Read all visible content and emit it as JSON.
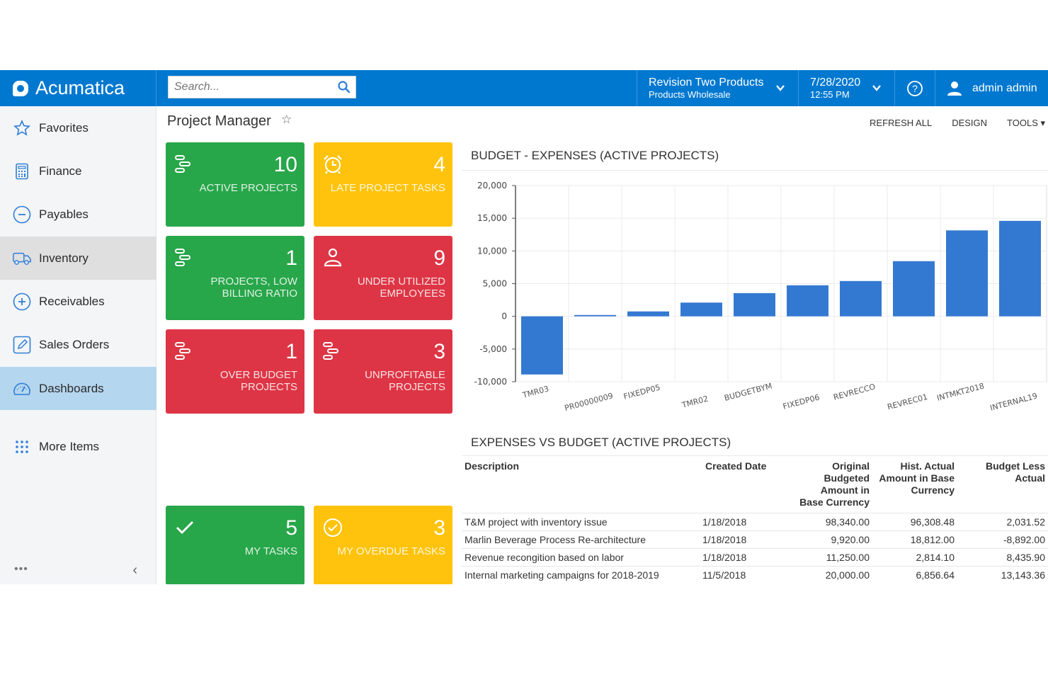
{
  "header": {
    "brand": "Acumatica",
    "search_placeholder": "Search...",
    "company": {
      "name": "Revision Two Products",
      "branch": "Products Wholesale"
    },
    "date": "7/28/2020",
    "time": "12:55 PM",
    "user": "admin admin"
  },
  "sidebar": {
    "items": [
      {
        "label": "Favorites",
        "icon": "star-icon"
      },
      {
        "label": "Finance",
        "icon": "calculator-icon"
      },
      {
        "label": "Payables",
        "icon": "minus-circle-icon"
      },
      {
        "label": "Inventory",
        "icon": "truck-icon"
      },
      {
        "label": "Receivables",
        "icon": "plus-circle-icon"
      },
      {
        "label": "Sales Orders",
        "icon": "pencil-square-icon"
      },
      {
        "label": "Dashboards",
        "icon": "gauge-icon"
      },
      {
        "label": "More Items",
        "icon": "grid-dots-icon"
      }
    ],
    "more_label": "•••",
    "collapse_label": "‹"
  },
  "page": {
    "title": "Project Manager",
    "star": "☆",
    "toolbar": {
      "refresh": "REFRESH ALL",
      "design": "DESIGN",
      "tools": "TOOLS ▾"
    }
  },
  "tiles": [
    {
      "value": "10",
      "label": "ACTIVE PROJECTS",
      "color": "green",
      "icon": "projects-icon"
    },
    {
      "value": "4",
      "label": "LATE PROJECT TASKS",
      "color": "yellow",
      "icon": "alarm-clock-icon"
    },
    {
      "value": "1",
      "label": "PROJECTS, LOW BILLING RATIO",
      "color": "green",
      "icon": "projects-icon"
    },
    {
      "value": "9",
      "label": "UNDER UTILIZED EMPLOYEES",
      "color": "red",
      "icon": "user-icon"
    },
    {
      "value": "1",
      "label": "OVER BUDGET PROJECTS",
      "color": "red",
      "icon": "projects-icon"
    },
    {
      "value": "3",
      "label": "UNPROFITABLE PROJECTS",
      "color": "red",
      "icon": "projects-icon"
    },
    {
      "value": "5",
      "label": "MY TASKS",
      "color": "green",
      "icon": "checkmark-icon"
    },
    {
      "value": "3",
      "label": "MY OVERDUE TASKS",
      "color": "yellow",
      "icon": "check-circle-icon"
    }
  ],
  "colors": {
    "green": "#28a64a",
    "yellow": "#ffc30d",
    "red": "#dd3545",
    "brand": "#0078d0",
    "bar": "#3479d1"
  },
  "chart_data": {
    "type": "bar",
    "title": "BUDGET - EXPENSES (ACTIVE PROJECTS)",
    "xlabel": "",
    "ylabel": "",
    "categories": [
      "TMR03",
      "PR00000009",
      "FIXEDP05",
      "TMR02",
      "BUDGETBYM",
      "FIXEDP06",
      "REVRECCO",
      "REVREC01",
      "INTMKT2018",
      "INTERNAL19"
    ],
    "values": [
      -8892,
      200,
      750,
      2100,
      3550,
      4750,
      5400,
      8436,
      13143,
      14600
    ],
    "ylim": [
      -10000,
      20000
    ],
    "yticks": [
      20000,
      15000,
      10000,
      5000,
      0,
      -5000,
      -10000
    ],
    "ytick_labels": [
      "20,000",
      "15,000",
      "10,000",
      "5,000",
      "0",
      "-5,000",
      "-10,000"
    ],
    "grid": true,
    "legend": "none"
  },
  "table": {
    "title": "EXPENSES VS BUDGET (ACTIVE PROJECTS)",
    "columns": [
      "Description",
      "Created Date",
      "Original Budgeted Amount in Base Currency",
      "Hist. Actual Amount in Base Currency",
      "Budget Less Actual"
    ],
    "rows": [
      [
        "T&M project with inventory issue",
        "1/18/2018",
        "98,340.00",
        "96,308.48",
        "2,031.52"
      ],
      [
        "Marlin Beverage Process Re-architecture",
        "1/18/2018",
        "9,920.00",
        "18,812.00",
        "-8,892.00"
      ],
      [
        "Revenue recongition based on labor",
        "1/18/2018",
        "11,250.00",
        "2,814.10",
        "8,435.90"
      ],
      [
        "Internal marketing campaigns for 2018-2019",
        "11/5/2018",
        "20,000.00",
        "6,856.64",
        "13,143.36"
      ]
    ]
  }
}
